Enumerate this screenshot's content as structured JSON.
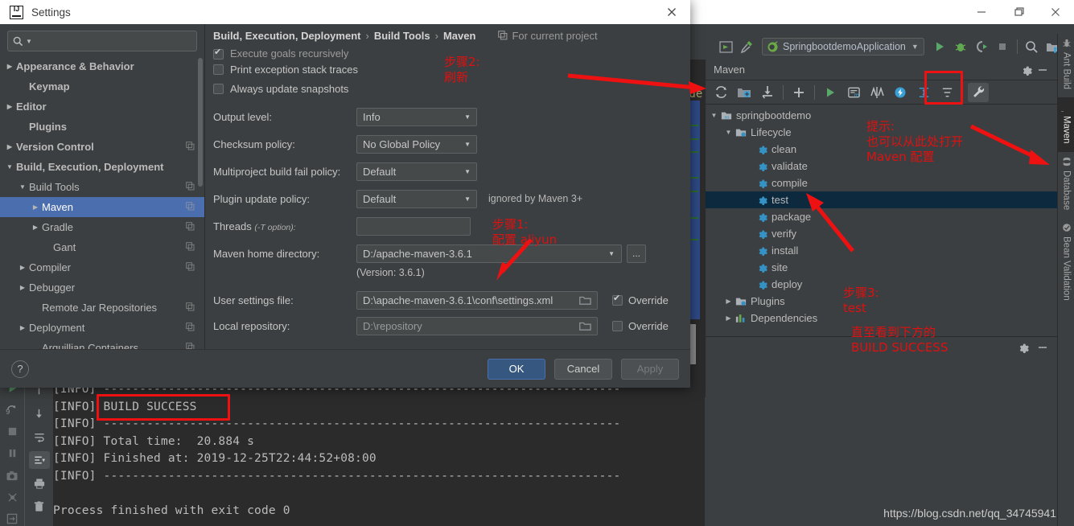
{
  "window": {
    "minimize": "–",
    "maximize": "❐",
    "close": "✕"
  },
  "ide_toolbar": {
    "run_config": "SpringbootdemoApplication",
    "icons": [
      "project-structure-icon",
      "build-hammer-icon",
      "run-icon",
      "debug-icon",
      "run-coverage-icon",
      "stop-icon",
      "search-everywhere-icon",
      "project-icon"
    ]
  },
  "editor": {
    "visible_text": "ude"
  },
  "maven_panel": {
    "title": "Maven",
    "settings_icon": "gear-icon",
    "hide_icon": "minimize-icon",
    "toolbar": [
      {
        "name": "reimport-icon",
        "label": "Reimport"
      },
      {
        "name": "generate-sources-icon",
        "label": "Generate Sources and Update Folders"
      },
      {
        "name": "download-sources-icon",
        "label": "Download Sources and/or Documentation"
      },
      {
        "name": "add-maven-project-icon",
        "label": "Add Maven Projects"
      },
      {
        "name": "run-icon",
        "label": "Run Maven Build"
      },
      {
        "name": "execute-goal-icon",
        "label": "Execute Maven Goal"
      },
      {
        "name": "toggle-skip-tests-icon",
        "label": "Toggle Skip Tests Mode"
      },
      {
        "name": "toggle-offline-icon",
        "label": "Toggle Offline Mode"
      },
      {
        "name": "expand-all-icon",
        "label": "Expand All"
      },
      {
        "name": "collapse-all-icon",
        "label": "Collapse All"
      },
      {
        "name": "maven-settings-wrench-icon",
        "label": "Maven Settings"
      }
    ],
    "tree": [
      {
        "label": "springbootdemo",
        "icon": "maven-project-icon",
        "level": 0,
        "arrow": "expanded",
        "selected": false
      },
      {
        "label": "Lifecycle",
        "icon": "lifecycle-folder-icon",
        "level": 1,
        "arrow": "expanded",
        "selected": false
      },
      {
        "label": "clean",
        "icon": "goal-gear-icon",
        "level": 2,
        "arrow": "none",
        "selected": false
      },
      {
        "label": "validate",
        "icon": "goal-gear-icon",
        "level": 2,
        "arrow": "none",
        "selected": false
      },
      {
        "label": "compile",
        "icon": "goal-gear-icon",
        "level": 2,
        "arrow": "none",
        "selected": false
      },
      {
        "label": "test",
        "icon": "goal-gear-icon",
        "level": 2,
        "arrow": "none",
        "selected": true
      },
      {
        "label": "package",
        "icon": "goal-gear-icon",
        "level": 2,
        "arrow": "none",
        "selected": false
      },
      {
        "label": "verify",
        "icon": "goal-gear-icon",
        "level": 2,
        "arrow": "none",
        "selected": false
      },
      {
        "label": "install",
        "icon": "goal-gear-icon",
        "level": 2,
        "arrow": "none",
        "selected": false
      },
      {
        "label": "site",
        "icon": "goal-gear-icon",
        "level": 2,
        "arrow": "none",
        "selected": false
      },
      {
        "label": "deploy",
        "icon": "goal-gear-icon",
        "level": 2,
        "arrow": "none",
        "selected": false
      },
      {
        "label": "Plugins",
        "icon": "plugins-folder-icon",
        "level": 1,
        "arrow": "collapsed",
        "selected": false
      },
      {
        "label": "Dependencies",
        "icon": "dependencies-icon",
        "level": 1,
        "arrow": "collapsed",
        "selected": false
      }
    ]
  },
  "right_rail": [
    {
      "label": "Ant Build",
      "icon": "ant-icon",
      "active": false
    },
    {
      "label": "Maven",
      "icon": "maven-m-icon",
      "active": true
    },
    {
      "label": "Database",
      "icon": "database-icon",
      "active": false
    },
    {
      "label": "Bean Validation",
      "icon": "bean-validation-icon",
      "active": false
    }
  ],
  "console": {
    "lines": [
      "[INFO] ------------------------------------------------------------------------",
      "[INFO] BUILD SUCCESS",
      "[INFO] ------------------------------------------------------------------------",
      "[INFO] Total time:  20.884 s",
      "[INFO] Finished at: 2019-12-25T22:44:52+08:00",
      "[INFO] ------------------------------------------------------------------------",
      "",
      "Process finished with exit code 0"
    ],
    "gutter_icons": [
      "scroll-to-top-icon",
      "scroll-to-bottom-icon",
      "soft-wrap-icon",
      "scroll-to-end-icon",
      "print-icon",
      "clear-all-icon"
    ],
    "run_rail_icons": [
      "rerun-icon",
      "rerun-failed-icon",
      "stop-icon",
      "pause-icon",
      "camera-icon",
      "thread-dump-icon",
      "export-icon"
    ]
  },
  "dialog": {
    "title": "Settings",
    "logo": "intellij-idea-logo-icon",
    "close": "✕",
    "search": {
      "placeholder": "",
      "value": "",
      "icon": "search-icon"
    },
    "tree": [
      {
        "label": "Appearance & Behavior",
        "level": 0,
        "arrow": "collapsed",
        "bold": true,
        "copy": false,
        "selected": false
      },
      {
        "label": "Keymap",
        "level": 1,
        "arrow": "none",
        "bold": true,
        "copy": false,
        "selected": false
      },
      {
        "label": "Editor",
        "level": 0,
        "arrow": "collapsed",
        "bold": true,
        "copy": false,
        "selected": false
      },
      {
        "label": "Plugins",
        "level": 1,
        "arrow": "none",
        "bold": true,
        "copy": false,
        "selected": false
      },
      {
        "label": "Version Control",
        "level": 0,
        "arrow": "collapsed",
        "bold": true,
        "copy": true,
        "selected": false
      },
      {
        "label": "Build, Execution, Deployment",
        "level": 0,
        "arrow": "expanded",
        "bold": true,
        "copy": false,
        "selected": false
      },
      {
        "label": "Build Tools",
        "level": 1,
        "arrow": "expanded",
        "bold": false,
        "copy": true,
        "selected": false
      },
      {
        "label": "Maven",
        "level": 2,
        "arrow": "collapsed",
        "bold": false,
        "copy": true,
        "selected": true
      },
      {
        "label": "Gradle",
        "level": 2,
        "arrow": "collapsed",
        "bold": false,
        "copy": true,
        "selected": false
      },
      {
        "label": "Gant",
        "level": 3,
        "arrow": "none",
        "bold": false,
        "copy": true,
        "selected": false
      },
      {
        "label": "Compiler",
        "level": 1,
        "arrow": "collapsed",
        "bold": false,
        "copy": true,
        "selected": false
      },
      {
        "label": "Debugger",
        "level": 1,
        "arrow": "collapsed",
        "bold": false,
        "copy": false,
        "selected": false
      },
      {
        "label": "Remote Jar Repositories",
        "level": 2,
        "arrow": "none",
        "bold": false,
        "copy": true,
        "selected": false
      },
      {
        "label": "Deployment",
        "level": 1,
        "arrow": "collapsed",
        "bold": false,
        "copy": true,
        "selected": false
      },
      {
        "label": "Arquillian Containers",
        "level": 2,
        "arrow": "none",
        "bold": false,
        "copy": true,
        "selected": false
      }
    ],
    "breadcrumb": {
      "part1": "Build, Execution, Deployment",
      "sep1": "›",
      "part2": "Build Tools",
      "sep2": "›",
      "part3": "Maven",
      "scope": "For current project",
      "scope_icon": "copy-scope-icon"
    },
    "form": {
      "cb_execute_recursively": {
        "label": "Execute goals recursively",
        "checked": true
      },
      "cb_print_traces": {
        "label": "Print exception stack traces",
        "checked": false
      },
      "cb_always_update": {
        "label": "Always update snapshots",
        "checked": false
      },
      "output_level": {
        "label": "Output level:",
        "value": "Info"
      },
      "checksum_policy": {
        "label": "Checksum policy:",
        "value": "No Global Policy"
      },
      "multiproject_fail_policy": {
        "label": "Multiproject build fail policy:",
        "value": "Default"
      },
      "plugin_update_policy": {
        "label": "Plugin update policy:",
        "value": "Default",
        "note": "ignored by Maven 3+"
      },
      "threads": {
        "label": "Threads",
        "label_opt": "(-T option):",
        "value": ""
      },
      "maven_home": {
        "label": "Maven home directory:",
        "value": "D:/apache-maven-3.6.1",
        "browse": "..."
      },
      "version_note": "(Version: 3.6.1)",
      "user_settings": {
        "label": "User settings file:",
        "value": "D:\\apache-maven-3.6.1\\conf\\settings.xml",
        "override_label": "Override",
        "override_checked": true
      },
      "local_repository": {
        "label": "Local repository:",
        "value": "D:\\repository",
        "override_label": "Override",
        "override_checked": false
      }
    },
    "footer": {
      "help": "?",
      "ok": "OK",
      "cancel": "Cancel",
      "apply": "Apply"
    }
  },
  "annotations": {
    "step2": "步骤2:\n刷新",
    "step1": "步骤1:\n配置 aliyun",
    "hint": "提示:\n也可以从此处打开\nMaven 配置",
    "step3": "步骤3:\ntest",
    "step3_tail": "直至看到下方的\nBUILD SUCCESS",
    "color": "#ee1111"
  },
  "watermark": "https://blog.csdn.net/qq_34745941"
}
